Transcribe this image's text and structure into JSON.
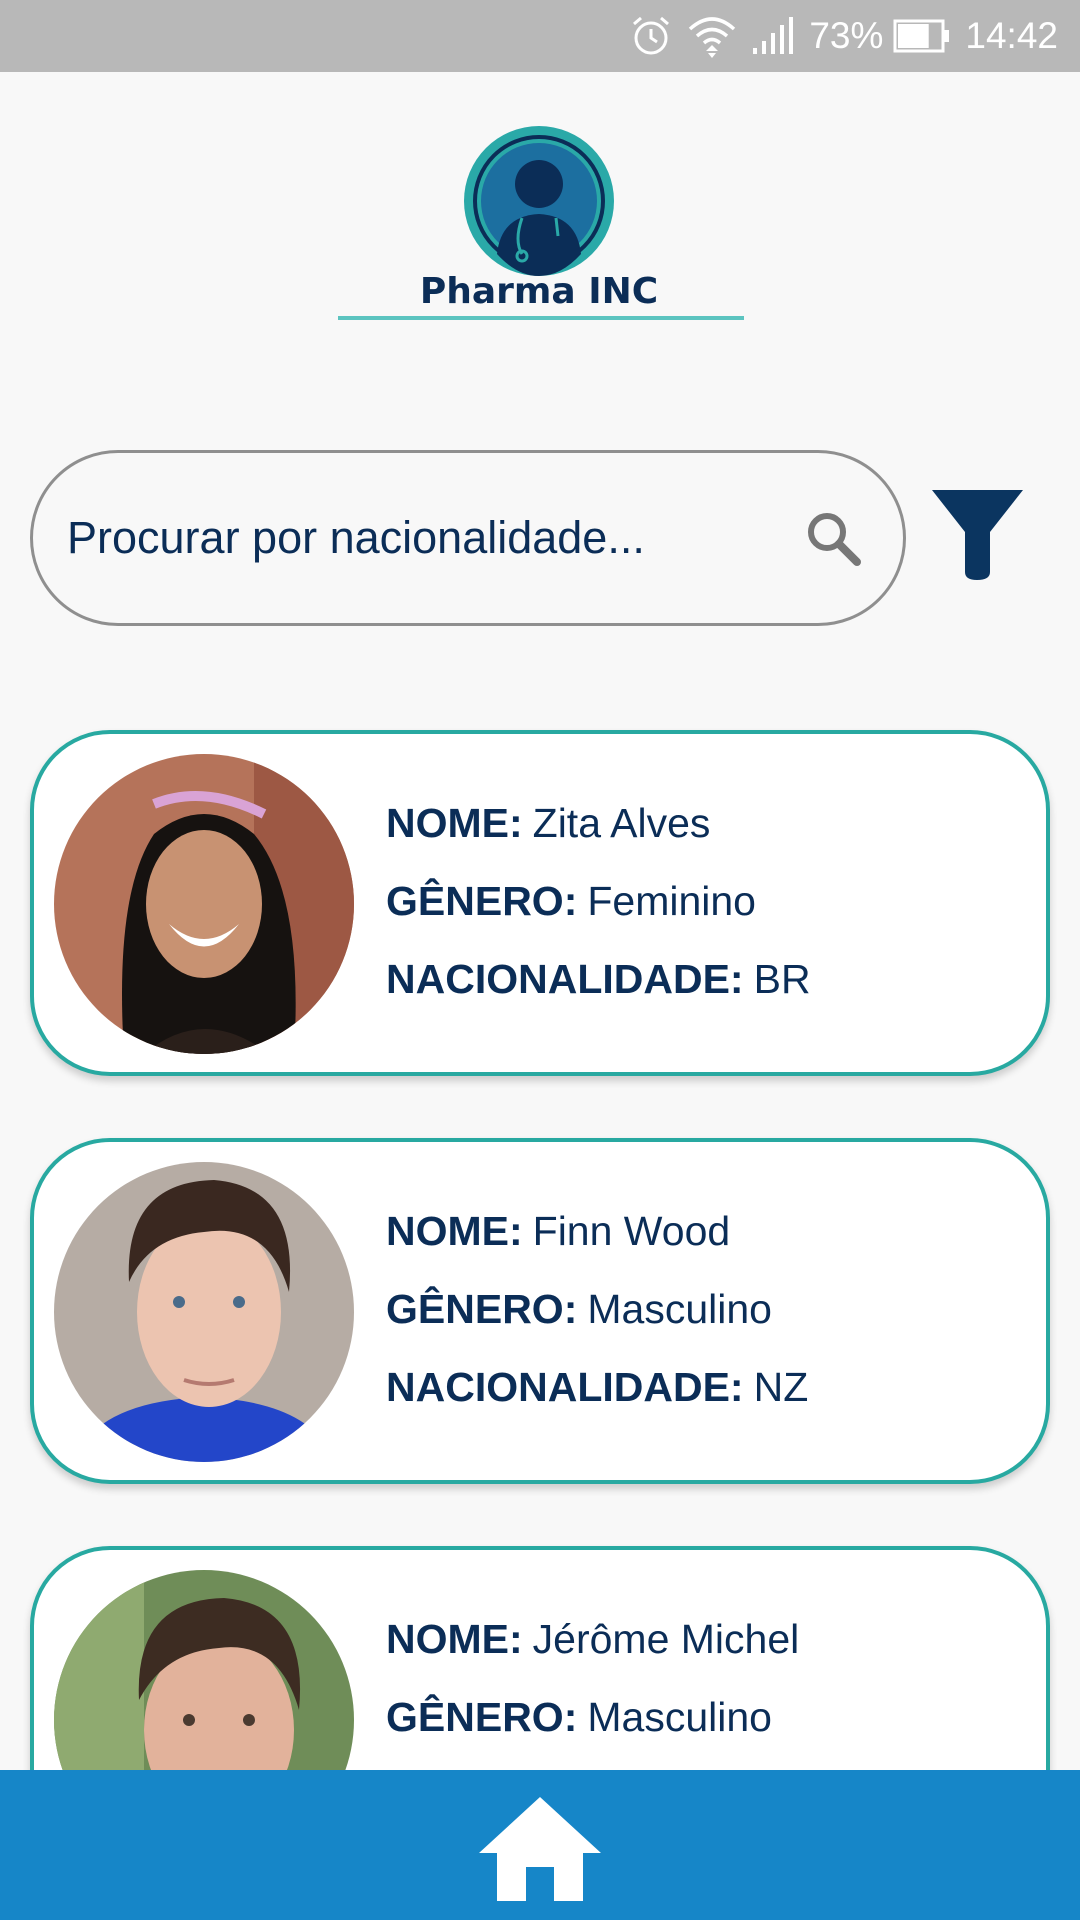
{
  "status_bar": {
    "alarm_icon": "alarm-clock-icon",
    "wifi_icon": "wifi-icon",
    "signal_icon": "signal-icon",
    "battery_percent": "73%",
    "battery_level": 0.73,
    "time": "14:42"
  },
  "brand": {
    "name": "Pharma INC",
    "primary_color": "#0b2d57",
    "accent_color": "#28a9a1",
    "nav_color": "#1686c8"
  },
  "search": {
    "placeholder": "Procurar por nacionalidade...",
    "value": "",
    "icon": "search-icon",
    "filter_icon": "filter-icon"
  },
  "labels": {
    "name": "NOME:",
    "gender": "GÊNERO:",
    "nationality": "NACIONALIDADE:"
  },
  "patients": [
    {
      "name": "Zita Alves",
      "gender": "Feminino",
      "nationality": "BR"
    },
    {
      "name": "Finn Wood",
      "gender": "Masculino",
      "nationality": "NZ"
    },
    {
      "name": "Jérôme Michel",
      "gender": "Masculino"
    }
  ],
  "bottom_nav": {
    "home_icon": "home-icon"
  }
}
